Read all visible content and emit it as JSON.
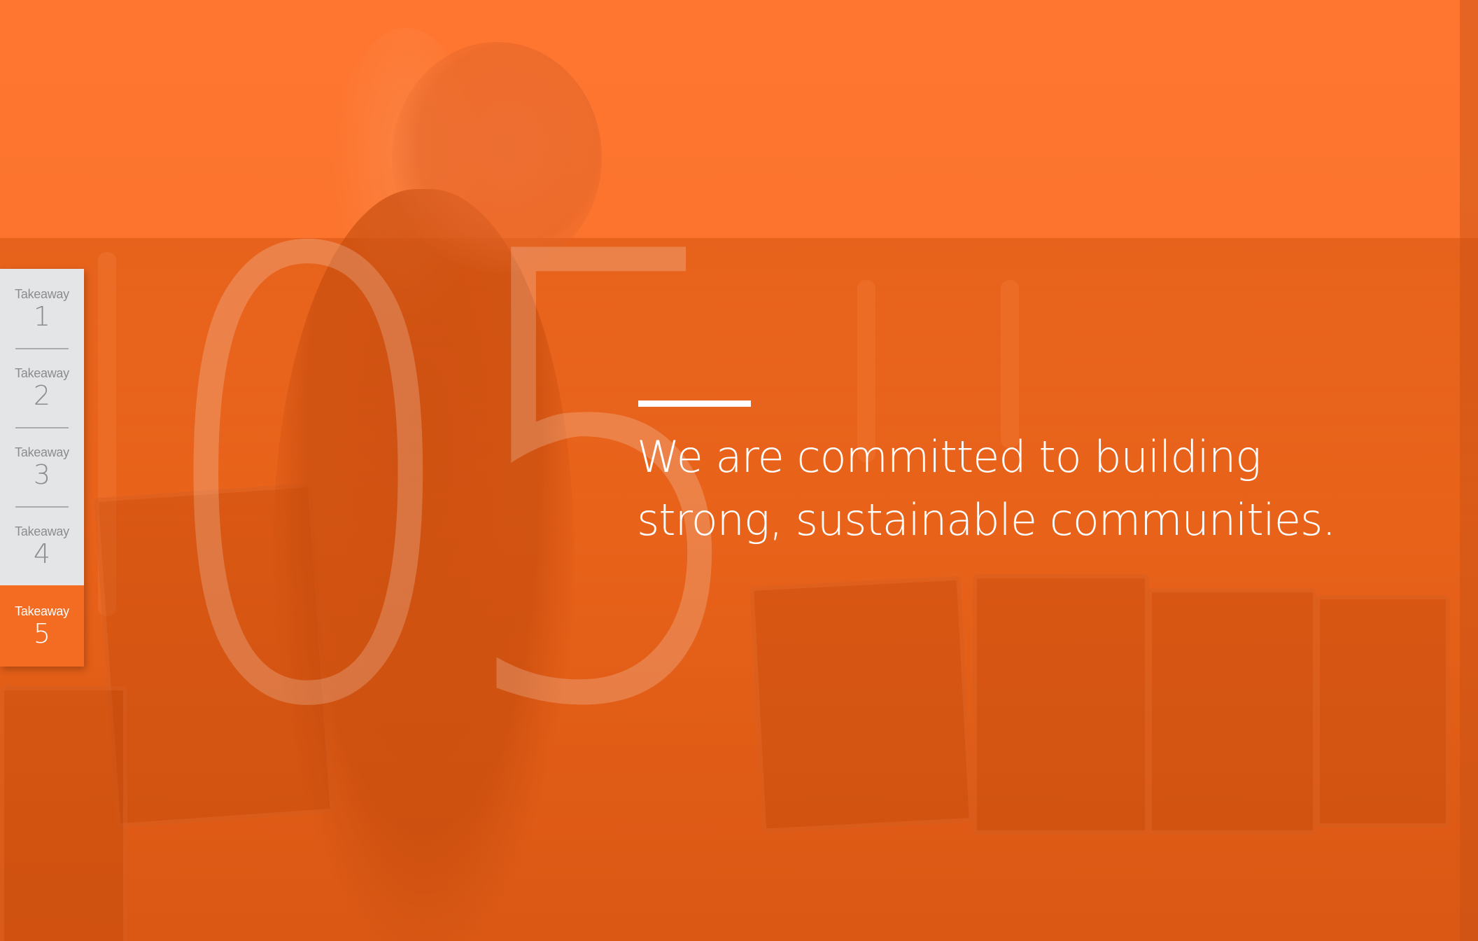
{
  "slide": {
    "big_number": "05",
    "headline_line1": "We are committed to building",
    "headline_line2": "strong, sustainable communities."
  },
  "nav": {
    "items": [
      {
        "label": "Takeaway",
        "number": "1",
        "active": false
      },
      {
        "label": "Takeaway",
        "number": "2",
        "active": false
      },
      {
        "label": "Takeaway",
        "number": "3",
        "active": false
      },
      {
        "label": "Takeaway",
        "number": "4",
        "active": false
      },
      {
        "label": "Takeaway",
        "number": "5",
        "active": true
      }
    ]
  },
  "colors": {
    "brand_orange": "#f36c21",
    "nav_background": "#e4e5e7",
    "nav_text": "#8a8c8f",
    "headline_text": "#ffffff"
  }
}
